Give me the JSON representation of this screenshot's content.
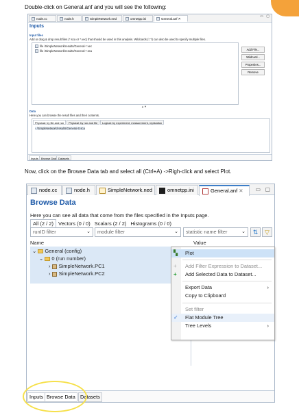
{
  "intro_text": "Double-click on General.anf and you will see the following:",
  "middle_text": "Now, click on the Browse Data tab and select all (Ctrl+A) ->Righ-click and select Plot.",
  "small_editor": {
    "tabs": [
      "node.cc",
      "node.h",
      "SimpleNetwork.ned",
      "omnetpp.ini",
      "General.anf"
    ],
    "page_title": "Inputs",
    "input_files_heading": "Input files",
    "input_files_desc": "Add or drag & drop result files (*.sca or *.vec) that should be used in this analysis. Wildcards (*,?) can also be used to specify multiple files.",
    "files": [
      "file /SimpleNetwork/results/General-*.vec",
      "file /SimpleNetwork/results/General-*.sca"
    ],
    "buttons": [
      "Add File...",
      "Wildcard...",
      "Properties...",
      "Remove"
    ],
    "data_heading": "Data",
    "data_desc": "Here you can browse the result files and their contents.",
    "data_tabs": [
      "Physical: by file and run",
      "Physical: by run and file",
      "Logical: by experiment, measurement, replication"
    ],
    "data_row": "/SimpleNetwork/results/General-0.sca",
    "bottom_tabs": [
      "Inputs",
      "Browse Data",
      "Datasets"
    ]
  },
  "big_editor": {
    "tabs": [
      "node.cc",
      "node.h",
      "SimpleNetwork.ned",
      "omnetpp.ini",
      "General.anf"
    ],
    "page_title": "Browse Data",
    "description": "Here you can see all data that come from the files specified in the Inputs page.",
    "data_tabs": [
      "All (2 / 2)",
      "Vectors (0 / 0)",
      "Scalars (2 / 2)",
      "Histograms (0 / 0)"
    ],
    "filters": {
      "run": "runID filter",
      "module": "module filter",
      "statistic": "statistic name filter"
    },
    "columns": {
      "name": "Name",
      "value": "Value"
    },
    "tree": [
      "General (config)",
      "0 (run number)",
      "SimpleNetwork.PC1",
      "SimpleNetwork.PC2"
    ],
    "context_menu": {
      "plot": "Plot",
      "add_filter": "Add Filter Expression to Dataset...",
      "add_selected": "Add Selected Data to Dataset...",
      "export": "Export Data",
      "copy": "Copy to Clipboard",
      "set_filter": "Set filter",
      "flat_tree": "Flat Module Tree",
      "tree_levels": "Tree Levels"
    },
    "bottom_tabs": [
      "Inputs",
      "Browse Data",
      "Datasets"
    ]
  }
}
